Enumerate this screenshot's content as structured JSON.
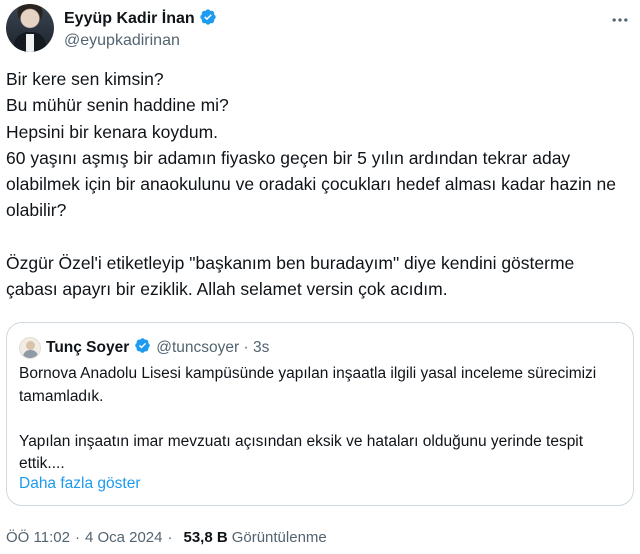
{
  "author": {
    "name": "Eyyüp Kadir İnan",
    "handle": "@eyupkadirinan",
    "verified": true,
    "verified_color": "#1d9bf0"
  },
  "menu_icon": "more-horizontal-icon",
  "tweet": {
    "text": "Bir kere sen kimsin?\nBu mühür senin haddine mi?\nHepsini bir kenara koydum.\n60 yaşını aşmış bir adamın fiyasko geçen bir 5 yılın ardından tekrar aday olabilmek için bir anaokulunu ve oradaki çocukları hedef alması kadar hazin ne olabilir?\n\nÖzgür Özel'i etiketleyip  \"başkanım ben buradayım\" diye kendini gösterme çabası apayrı bir eziklik. Allah selamet versin çok acıdım."
  },
  "quote": {
    "name": "Tunç Soyer",
    "handle": "@tuncsoyer · 3s",
    "verified": true,
    "text": "Bornova Anadolu Lisesi kampüsünde yapılan inşaatla ilgili yasal inceleme sürecimizi tamamladık.\n\nYapılan inşaatın imar mevzuatı açısından eksik ve hataları olduğunu yerinde tespit ettik....",
    "show_more": "Daha fazla göster"
  },
  "meta": {
    "time": "ÖÖ 11:02",
    "separator1": "·",
    "date": "4 Oca 2024",
    "separator2": "·",
    "views_count": "53,8 B",
    "views_label": "Görüntülenme"
  }
}
